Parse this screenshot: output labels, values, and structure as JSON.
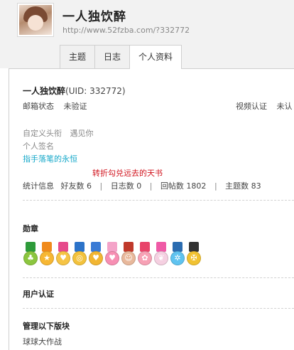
{
  "profile": {
    "username": "一人独饮醉",
    "url": "http://www.52fzba.com/?332772"
  },
  "tabs": [
    {
      "label": "主题"
    },
    {
      "label": "日志"
    },
    {
      "label": "个人资料"
    }
  ],
  "info": {
    "name_line": "一人独饮醉",
    "uid_text": "(UID: 332772)",
    "email_label": "邮箱状态",
    "email_value": "未验证",
    "video_label": "视频认证",
    "video_value": "未认",
    "custom_title_label": "自定义头衔",
    "custom_title_value": "遇见你",
    "signature_label": "个人签名",
    "signature_text": "指手落笔的永恒",
    "red_text": "转折勾兑远去的天书",
    "stats": {
      "label": "统计信息",
      "friends": "好友数 6",
      "logs": "日志数 0",
      "replies": "回帖数 1802",
      "threads": "主题数 83",
      "sep": "|"
    }
  },
  "sections": {
    "medals_title": "勋章",
    "auth_title": "用户认证",
    "manage_title": "管理以下版块",
    "manage_item": "球球大作战"
  },
  "medals": [
    {
      "name": "leaf-medal-icon",
      "ribbon": "#2e9b3a",
      "disc": "#8cc63f",
      "glyph": "♣"
    },
    {
      "name": "orange-medal-icon",
      "ribbon": "#f08a1c",
      "disc": "#f7b733",
      "glyph": "★"
    },
    {
      "name": "heart-medal-icon",
      "ribbon": "#e64a8b",
      "disc": "#f6c445",
      "glyph": "♥"
    },
    {
      "name": "blue-medal-icon",
      "ribbon": "#2c73c9",
      "disc": "#f3c23c",
      "glyph": "◎"
    },
    {
      "name": "gold-heart-medal-icon",
      "ribbon": "#3a7bd5",
      "disc": "#f2b632",
      "glyph": "♥"
    },
    {
      "name": "pink-heart-medal-icon",
      "ribbon": "#f4a3c8",
      "disc": "#f78fb3",
      "glyph": "♥"
    },
    {
      "name": "portrait-medal-icon",
      "ribbon": "#c0392b",
      "disc": "#e8b89b",
      "glyph": "☺"
    },
    {
      "name": "flower-medal-icon",
      "ribbon": "#e8446a",
      "disc": "#f7a1b5",
      "glyph": "✿"
    },
    {
      "name": "bow-book-medal-icon",
      "ribbon": "#ef5aa6",
      "disc": "#f5d0e1",
      "glyph": "❦"
    },
    {
      "name": "snowflake-medal-icon",
      "ribbon": "#2b6cb0",
      "disc": "#5fc3f0",
      "glyph": "✲"
    },
    {
      "name": "cross-medal-icon",
      "ribbon": "#333333",
      "disc": "#f1c232",
      "glyph": "✠"
    }
  ]
}
